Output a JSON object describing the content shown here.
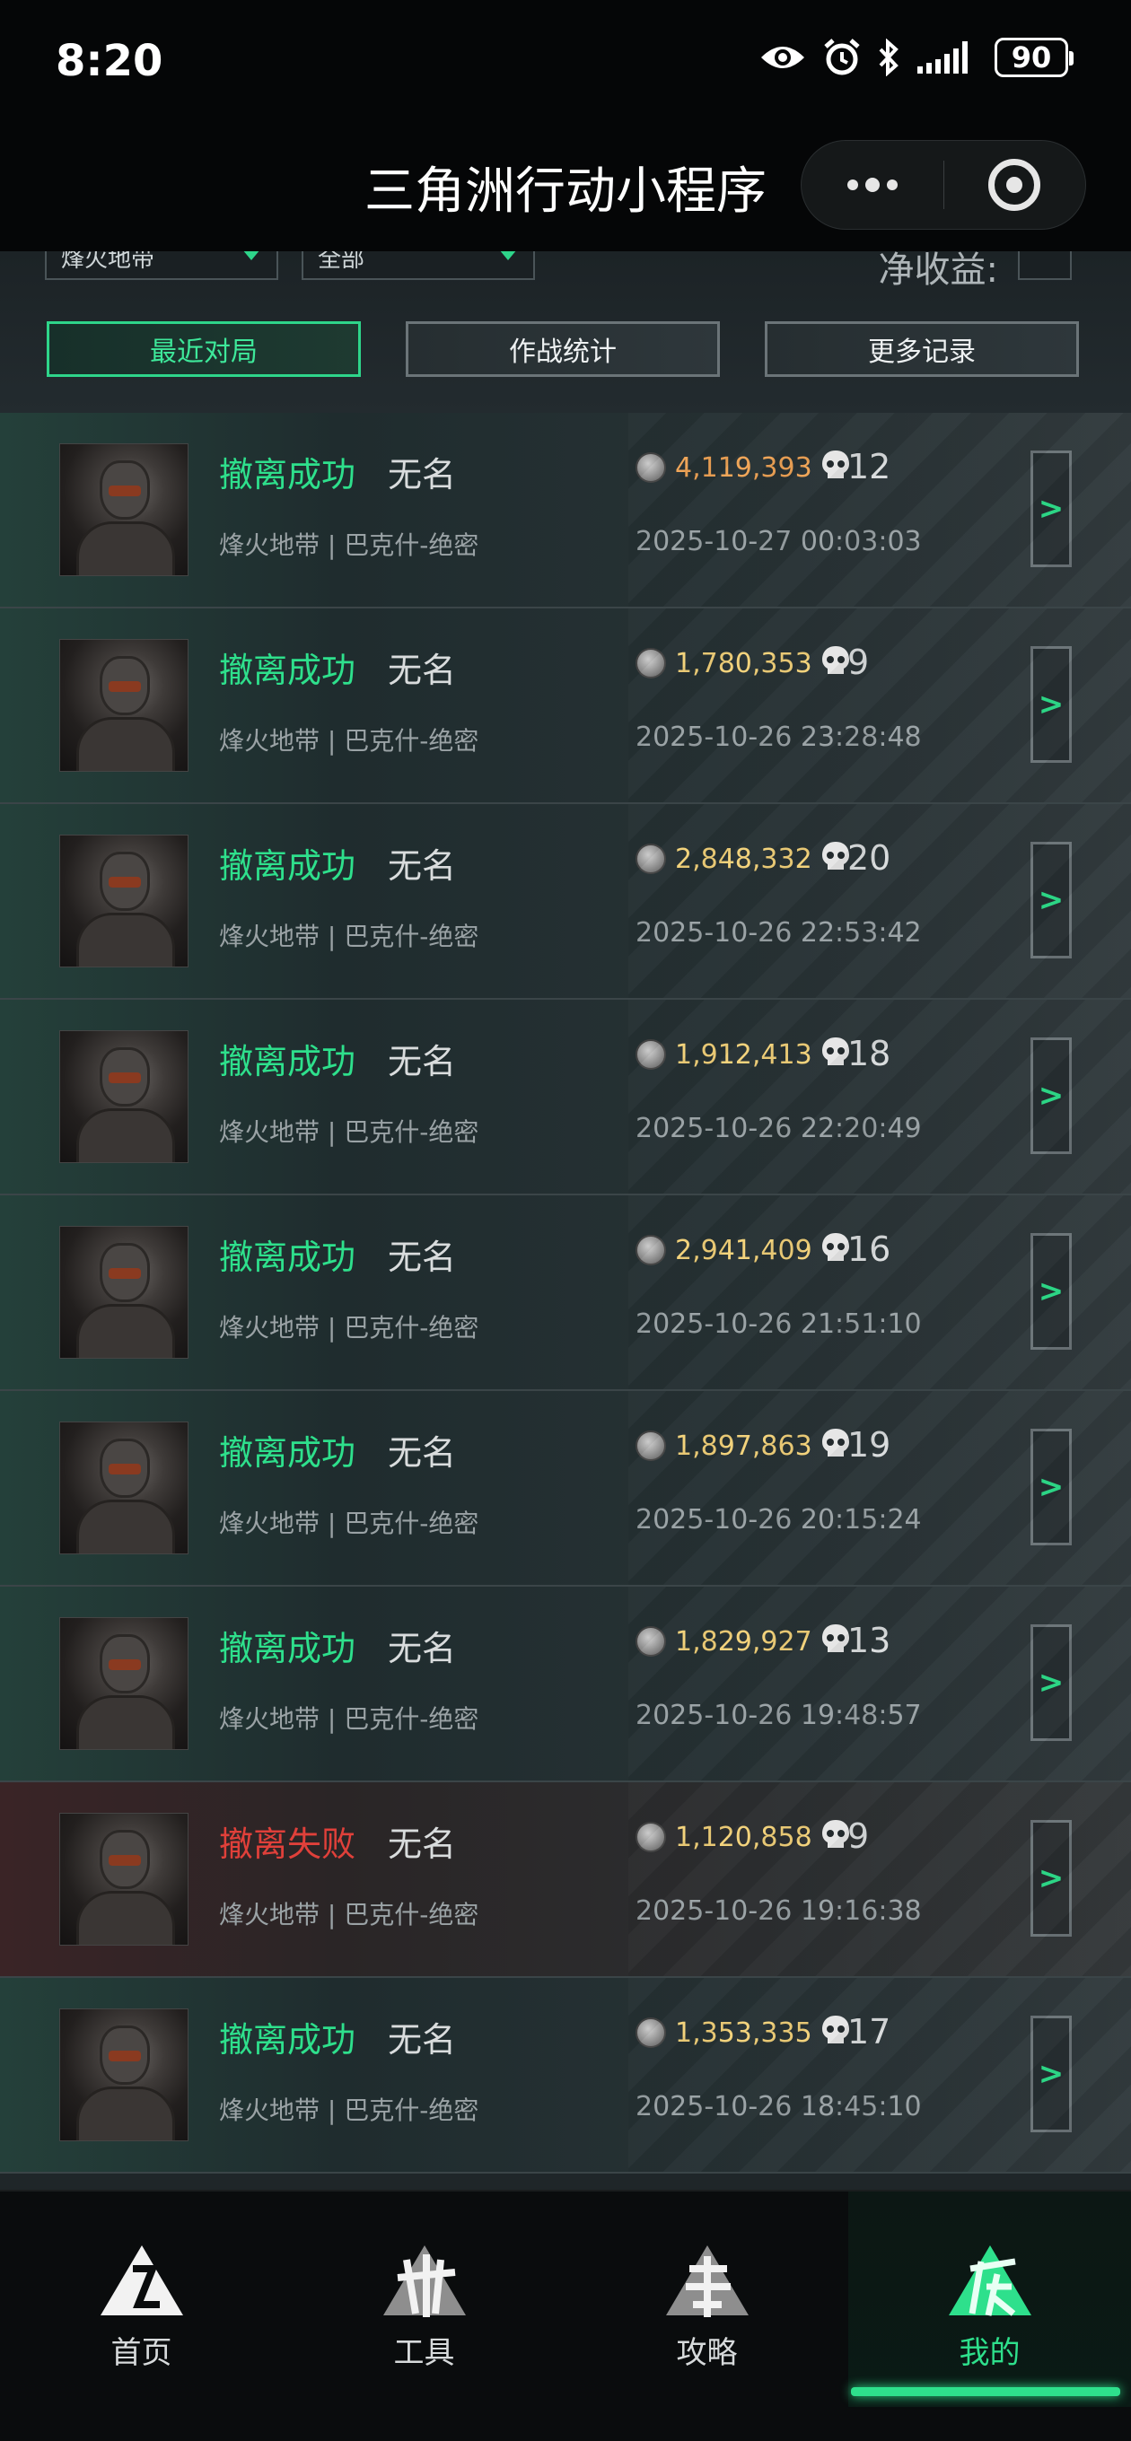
{
  "status_bar": {
    "time": "8:20",
    "battery": "90"
  },
  "title_bar": {
    "title": "三角洲行动小程序"
  },
  "filters": {
    "mode_select": "烽火地带",
    "scope_select": "全部",
    "net_income_label": "净收益:"
  },
  "tabs": [
    {
      "label": "最近对局",
      "active": true
    },
    {
      "label": "作战统计",
      "active": false
    },
    {
      "label": "更多记录",
      "active": false
    }
  ],
  "matches": [
    {
      "result": "撤离成功",
      "player": "无名",
      "mode": "烽火地带 | 巴克什-绝密",
      "value": "4,119,393",
      "kills": "12",
      "time": "2025-10-27 00:03:03",
      "success": true,
      "value_color": "orange"
    },
    {
      "result": "撤离成功",
      "player": "无名",
      "mode": "烽火地带 | 巴克什-绝密",
      "value": "1,780,353",
      "kills": "9",
      "time": "2025-10-26 23:28:48",
      "success": true,
      "value_color": "gold"
    },
    {
      "result": "撤离成功",
      "player": "无名",
      "mode": "烽火地带 | 巴克什-绝密",
      "value": "2,848,332",
      "kills": "20",
      "time": "2025-10-26 22:53:42",
      "success": true,
      "value_color": "gold"
    },
    {
      "result": "撤离成功",
      "player": "无名",
      "mode": "烽火地带 | 巴克什-绝密",
      "value": "1,912,413",
      "kills": "18",
      "time": "2025-10-26 22:20:49",
      "success": true,
      "value_color": "gold"
    },
    {
      "result": "撤离成功",
      "player": "无名",
      "mode": "烽火地带 | 巴克什-绝密",
      "value": "2,941,409",
      "kills": "16",
      "time": "2025-10-26 21:51:10",
      "success": true,
      "value_color": "gold"
    },
    {
      "result": "撤离成功",
      "player": "无名",
      "mode": "烽火地带 | 巴克什-绝密",
      "value": "1,897,863",
      "kills": "19",
      "time": "2025-10-26 20:15:24",
      "success": true,
      "value_color": "gold"
    },
    {
      "result": "撤离成功",
      "player": "无名",
      "mode": "烽火地带 | 巴克什-绝密",
      "value": "1,829,927",
      "kills": "13",
      "time": "2025-10-26 19:48:57",
      "success": true,
      "value_color": "gold"
    },
    {
      "result": "撤离失败",
      "player": "无名",
      "mode": "烽火地带 | 巴克什-绝密",
      "value": "1,120,858",
      "kills": "9",
      "time": "2025-10-26 19:16:38",
      "success": false,
      "value_color": "gold"
    },
    {
      "result": "撤离成功",
      "player": "无名",
      "mode": "烽火地带 | 巴克什-绝密",
      "value": "1,353,335",
      "kills": "17",
      "time": "2025-10-26 18:45:10",
      "success": true,
      "value_color": "gold"
    }
  ],
  "detail_arrow": ">",
  "bottom_nav": [
    {
      "label": "首页",
      "icon": "home-emblem-icon",
      "active": false
    },
    {
      "label": "工具",
      "icon": "tools-emblem-icon",
      "active": false
    },
    {
      "label": "攻略",
      "icon": "guide-emblem-icon",
      "active": false
    },
    {
      "label": "我的",
      "icon": "profile-emblem-icon",
      "active": true
    }
  ],
  "colors": {
    "accent": "#2ee08c",
    "fail": "#e0403a",
    "value": "#f3d27a",
    "value_highlight": "#f0a456"
  }
}
